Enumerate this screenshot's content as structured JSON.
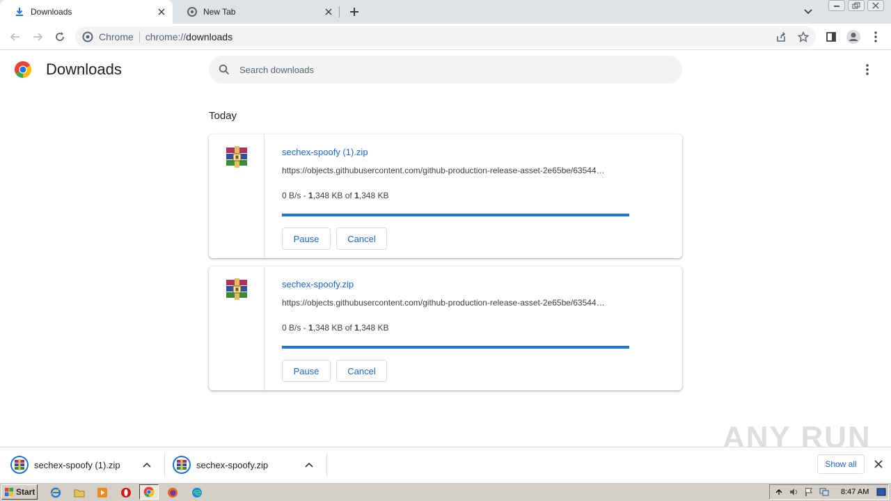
{
  "browser": {
    "tabs": [
      {
        "title": "Downloads",
        "active": true,
        "icon": "download-icon"
      },
      {
        "title": "New Tab",
        "active": false,
        "icon": "chrome-favicon"
      }
    ],
    "omnibox": {
      "site_name": "Chrome",
      "url_scheme": "chrome://",
      "url_host": "downloads"
    }
  },
  "page": {
    "title": "Downloads",
    "search_placeholder": "Search downloads",
    "section_date": "Today"
  },
  "downloads": [
    {
      "file_name": "sechex-spoofy (1).zip",
      "url": "https://objects.githubusercontent.com/github-production-release-asset-2e65be/63544…",
      "speed": "0 B/s - ",
      "done_size": "1",
      "done_rest": ",348 KB of ",
      "total_size": "1",
      "total_rest": ",348 KB",
      "progress": 1.0,
      "pause_label": "Pause",
      "cancel_label": "Cancel",
      "icon": "winrar-archive-icon"
    },
    {
      "file_name": "sechex-spoofy.zip",
      "url": "https://objects.githubusercontent.com/github-production-release-asset-2e65be/63544…",
      "speed": "0 B/s - ",
      "done_size": "1",
      "done_rest": ",348 KB of ",
      "total_size": "1",
      "total_rest": ",348 KB",
      "progress": 1.0,
      "pause_label": "Pause",
      "cancel_label": "Cancel",
      "icon": "winrar-archive-icon"
    }
  ],
  "shelf": {
    "items": [
      {
        "name": "sechex-spoofy (1).zip"
      },
      {
        "name": "sechex-spoofy.zip"
      }
    ],
    "show_all_label": "Show all"
  },
  "watermark": "ANY RUN",
  "taskbar": {
    "start_label": "Start",
    "clock": "8:47 AM"
  },
  "colors": {
    "accent": "#1a73e8",
    "link": "#1967d2",
    "tabstrip": "#dee1e6",
    "taskbar": "#d4d0c8"
  }
}
